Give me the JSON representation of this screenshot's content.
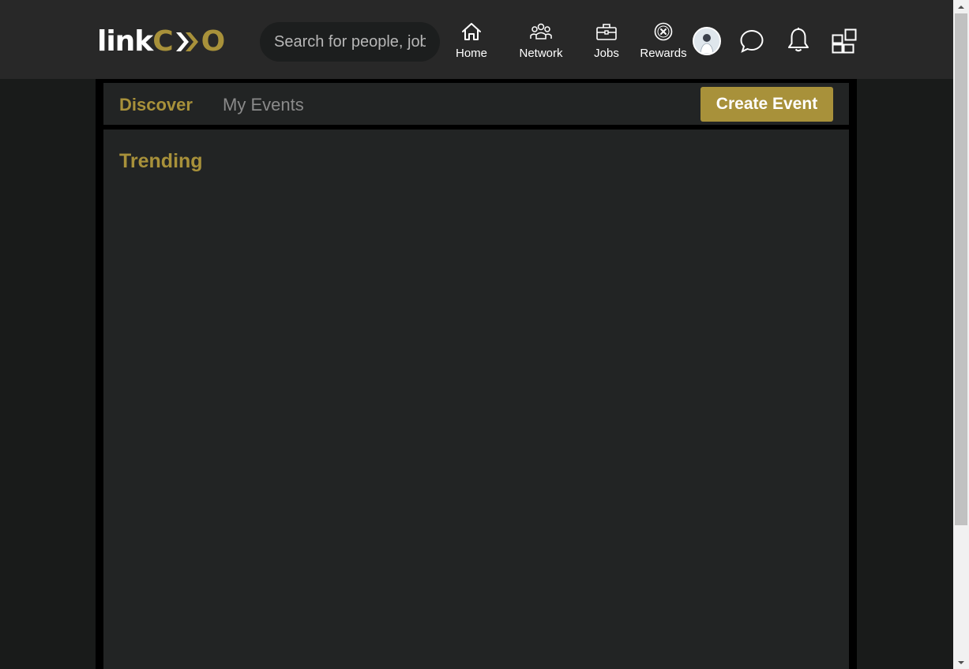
{
  "header": {
    "logo_left": "link",
    "logo_right_a": "C",
    "logo_right_b": "O",
    "search_placeholder": "Search for people, jobs",
    "nav": [
      {
        "label": "Home",
        "icon": "home-icon"
      },
      {
        "label": "Network",
        "icon": "network-icon"
      },
      {
        "label": "Jobs",
        "icon": "briefcase-icon"
      },
      {
        "label": "Rewards",
        "icon": "rewards-icon"
      }
    ]
  },
  "tabs": {
    "discover": "Discover",
    "my_events": "My Events",
    "active": "Discover"
  },
  "create_event_label": "Create Event",
  "main": {
    "section_title": "Trending"
  },
  "colors": {
    "accent": "#a8913a",
    "topbar": "#282828",
    "panel": "#222424",
    "background": "#191b1a"
  }
}
